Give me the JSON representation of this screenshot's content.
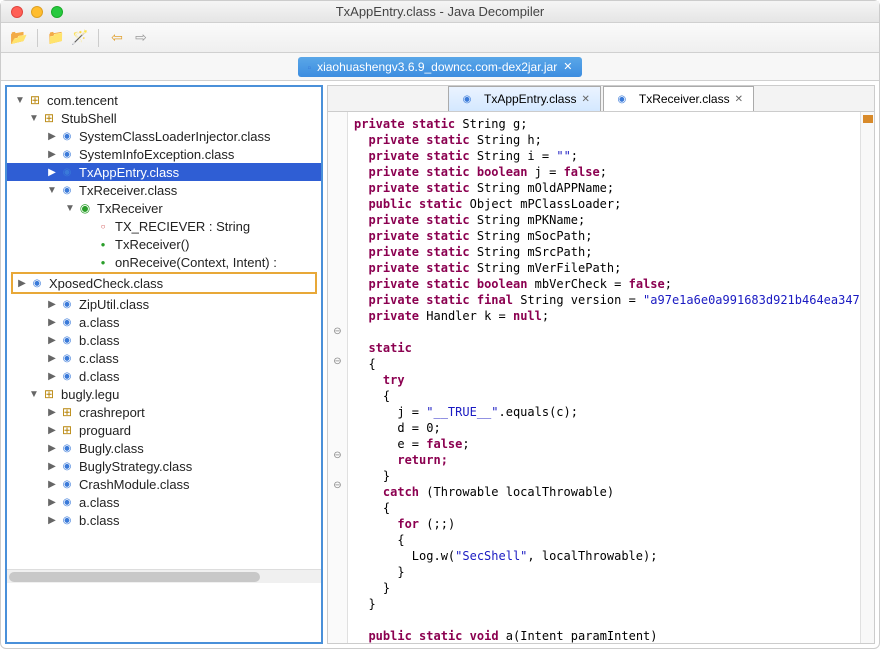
{
  "window": {
    "title": "TxAppEntry.class - Java Decompiler"
  },
  "file_tab": {
    "label": "xiaohuashengv3.6.9_downcc.com-dex2jar.jar"
  },
  "editor_tabs": [
    {
      "label": "TxAppEntry.class",
      "active": true
    },
    {
      "label": "TxReceiver.class",
      "active": false
    }
  ],
  "tree": [
    {
      "depth": 0,
      "expand": "down",
      "icon": "pkg",
      "label": "com.tencent"
    },
    {
      "depth": 1,
      "expand": "down",
      "icon": "pkg",
      "label": "StubShell"
    },
    {
      "depth": 2,
      "expand": "right",
      "icon": "class",
      "label": "SystemClassLoaderInjector.class"
    },
    {
      "depth": 2,
      "expand": "right",
      "icon": "class",
      "label": "SystemInfoException.class"
    },
    {
      "depth": 2,
      "expand": "right",
      "icon": "class",
      "label": "TxAppEntry.class",
      "selected": true
    },
    {
      "depth": 2,
      "expand": "down",
      "icon": "class",
      "label": "TxReceiver.class"
    },
    {
      "depth": 3,
      "expand": "down",
      "icon": "class-green",
      "label": "TxReceiver"
    },
    {
      "depth": 4,
      "expand": "",
      "icon": "field",
      "label": "TX_RECIEVER : String"
    },
    {
      "depth": 4,
      "expand": "",
      "icon": "method",
      "label": "TxReceiver()"
    },
    {
      "depth": 4,
      "expand": "",
      "icon": "method",
      "label": "onReceive(Context, Intent) :"
    },
    {
      "depth": 2,
      "expand": "right",
      "icon": "class",
      "label": "XposedCheck.class",
      "highlighted": true
    },
    {
      "depth": 2,
      "expand": "right",
      "icon": "class",
      "label": "ZipUtil.class"
    },
    {
      "depth": 2,
      "expand": "right",
      "icon": "class",
      "label": "a.class"
    },
    {
      "depth": 2,
      "expand": "right",
      "icon": "class",
      "label": "b.class"
    },
    {
      "depth": 2,
      "expand": "right",
      "icon": "class",
      "label": "c.class"
    },
    {
      "depth": 2,
      "expand": "right",
      "icon": "class",
      "label": "d.class"
    },
    {
      "depth": 1,
      "expand": "down",
      "icon": "pkg",
      "label": "bugly.legu"
    },
    {
      "depth": 2,
      "expand": "right",
      "icon": "pkg",
      "label": "crashreport"
    },
    {
      "depth": 2,
      "expand": "right",
      "icon": "pkg",
      "label": "proguard"
    },
    {
      "depth": 2,
      "expand": "right",
      "icon": "class",
      "label": "Bugly.class"
    },
    {
      "depth": 2,
      "expand": "right",
      "icon": "class",
      "label": "BuglyStrategy.class"
    },
    {
      "depth": 2,
      "expand": "right",
      "icon": "class",
      "label": "CrashModule.class"
    },
    {
      "depth": 2,
      "expand": "right",
      "icon": "class",
      "label": "a.class"
    },
    {
      "depth": 2,
      "expand": "right",
      "icon": "class",
      "label": "b.class"
    }
  ],
  "code": {
    "l1": "private",
    "l1b": "static",
    "l1c": "String g;",
    "l2": "private",
    "l2b": "static",
    "l2c": "String h;",
    "l3": "private",
    "l3b": "static",
    "l3c": "String i = ",
    "l3d": "\"\"",
    "l3e": ";",
    "l4": "private",
    "l4b": "static",
    "l4c": "boolean",
    "l4d": "j = ",
    "l4e": "false",
    "l4f": ";",
    "l5": "private",
    "l5b": "static",
    "l5c": "String mOldAPPName;",
    "l6": "public",
    "l6b": "static",
    "l6c": "Object mPClassLoader;",
    "l7": "private",
    "l7b": "static",
    "l7c": "String mPKName;",
    "l8": "private",
    "l8b": "static",
    "l8c": "String mSocPath;",
    "l9": "private",
    "l9b": "static",
    "l9c": "String mSrcPath;",
    "l10": "private",
    "l10b": "static",
    "l10c": "String mVerFilePath;",
    "l11": "private",
    "l11b": "static",
    "l11c": "boolean",
    "l11d": "mbVerCheck = ",
    "l11e": "false",
    "l11f": ";",
    "l12": "private",
    "l12b": "static",
    "l12c": "final",
    "l12d": "String version = ",
    "l12e": "\"a97e1a6e0a991683d921b464ea347",
    "l12f": "",
    "l13": "private",
    "l13b": "Handler k = ",
    "l13c": "null",
    "l13d": ";",
    "l15": "static",
    "l16": "{",
    "l17": "  try",
    "l18": "  {",
    "l19a": "    j = ",
    "l19b": "\"__TRUE__\"",
    "l19c": ".equals(c);",
    "l20": "    d = 0;",
    "l21a": "    e = ",
    "l21b": "false",
    "l21c": ";",
    "l22": "    return;",
    "l23": "  }",
    "l24": "  catch",
    "l24b": "(Throwable localThrowable)",
    "l25": "  {",
    "l26": "    for",
    "l26b": "(;;)",
    "l27": "    {",
    "l28a": "      Log.w(",
    "l28b": "\"SecShell\"",
    "l28c": ", localThrowable);",
    "l29": "    }",
    "l30": "  }",
    "l31": "}",
    "l33a": "public",
    "l33b": "static",
    "l33c": "void",
    "l33d": "a(Intent paramIntent)"
  }
}
